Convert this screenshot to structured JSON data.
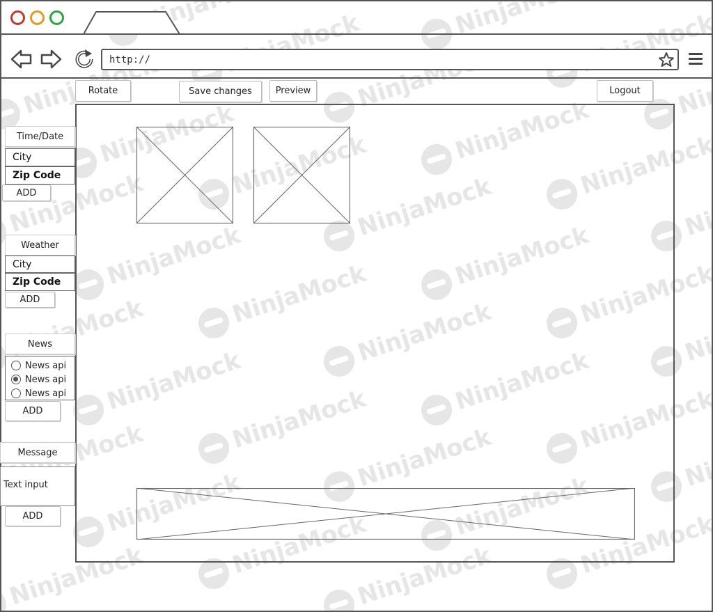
{
  "browser": {
    "url": "http://",
    "icons": [
      "back-icon",
      "forward-icon",
      "reload-icon",
      "star-icon",
      "menu-icon"
    ]
  },
  "toolbar": {
    "rotate_label": "Rotate",
    "save_label": "Save changes",
    "preview_label": "Preview",
    "logout_label": "Logout"
  },
  "sidebar": {
    "timedate": {
      "title": "Time/Date",
      "city": "City",
      "zip": "Zip Code",
      "add": "ADD"
    },
    "weather": {
      "title": "Weather",
      "city": "City",
      "zip": "Zip Code",
      "add": "ADD"
    },
    "news": {
      "title": "News",
      "options": [
        {
          "label": "News api",
          "selected": false
        },
        {
          "label": "News api",
          "selected": true
        },
        {
          "label": "News api",
          "selected": false
        }
      ],
      "add": "ADD"
    },
    "message": {
      "title": "Message",
      "text": "Text input",
      "add": "ADD"
    }
  },
  "watermark": "NinjaMock",
  "colors": {
    "close": "#c0392b",
    "minimize": "#e19a1e",
    "maximize": "#27a83b"
  }
}
